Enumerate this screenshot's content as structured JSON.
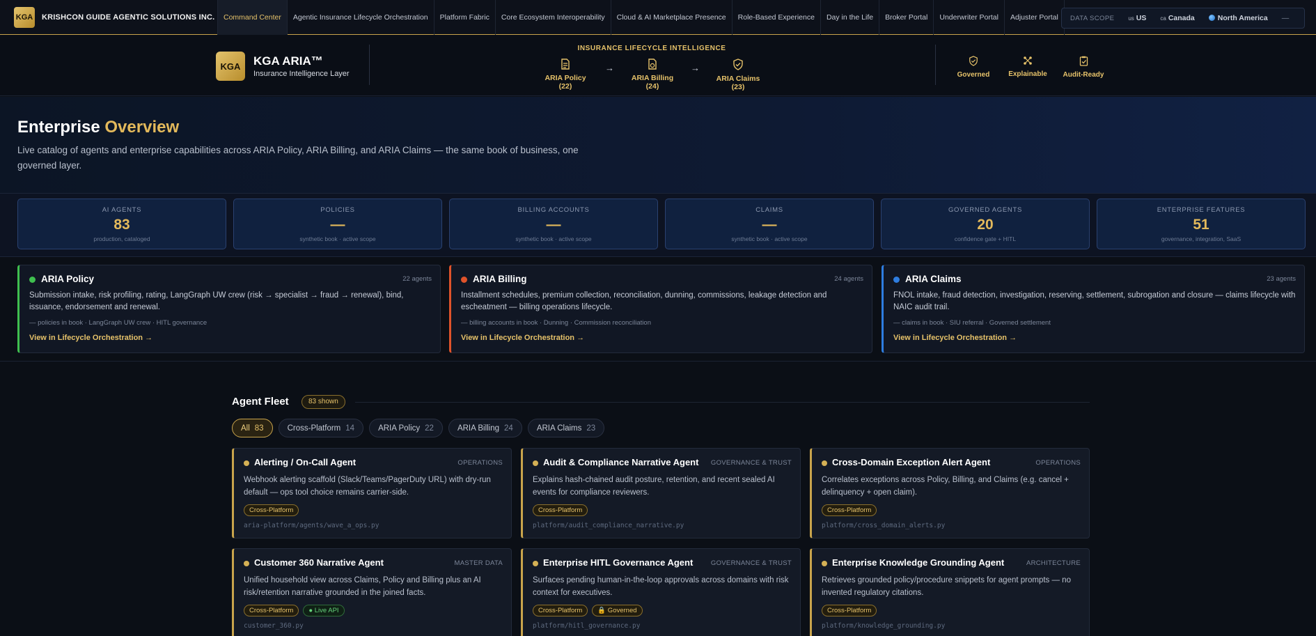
{
  "top_bar": {
    "logo_text": "KGA",
    "brand_name": "KRISHCON GUIDE AGENTIC SOLUTIONS INC.",
    "nav": [
      "Command Center",
      "Agentic Insurance Lifecycle Orchestration",
      "Platform Fabric",
      "Core Ecosystem Interoperability",
      "Cloud & AI Marketplace Presence",
      "Role-Based Experience",
      "Day in the Life",
      "Broker Portal",
      "Underwriter Portal",
      "Adjuster Portal"
    ],
    "active_nav": "Command Center",
    "data_scope": {
      "label": "DATA SCOPE",
      "options": [
        {
          "flag": "us",
          "label": "US"
        },
        {
          "flag": "ca",
          "label": "Canada"
        },
        {
          "flag": "globe",
          "label": "North America"
        }
      ],
      "trailing": "—"
    }
  },
  "aria_header": {
    "logo_text": "KGA",
    "title": "KGA ARIA™",
    "subtitle": "Insurance Intelligence Layer",
    "lifecycle_title": "INSURANCE LIFECYCLE INTELLIGENCE",
    "lifecycle_steps": [
      {
        "label": "ARIA Policy (22)",
        "icon": "document-icon"
      },
      {
        "label": "ARIA Billing (24)",
        "icon": "billing-document-icon"
      },
      {
        "label": "ARIA Claims (23)",
        "icon": "shield-check-icon"
      }
    ],
    "arrow": "→",
    "badges": [
      {
        "label": "Governed",
        "icon": "shield-icon"
      },
      {
        "label": "Explainable",
        "icon": "network-icon"
      },
      {
        "label": "Audit-Ready",
        "icon": "clipboard-check-icon"
      }
    ]
  },
  "hero": {
    "title_main": "Enterprise",
    "title_accent": "Overview",
    "description": "Live catalog of agents and enterprise capabilities across ARIA Policy, ARIA Billing, and ARIA Claims — the same book of business, one governed layer."
  },
  "stats": [
    {
      "label": "AI AGENTS",
      "value": "83",
      "sub": "production, cataloged"
    },
    {
      "label": "POLICIES",
      "value": "—",
      "sub": "synthetic book · active scope"
    },
    {
      "label": "BILLING ACCOUNTS",
      "value": "—",
      "sub": "synthetic book · active scope"
    },
    {
      "label": "CLAIMS",
      "value": "—",
      "sub": "synthetic book · active scope"
    },
    {
      "label": "GOVERNED AGENTS",
      "value": "20",
      "sub": "confidence gate + HITL"
    },
    {
      "label": "ENTERPRISE FEATURES",
      "value": "51",
      "sub": "governance, integration, SaaS"
    }
  ],
  "domains": [
    {
      "name": "ARIA Policy",
      "count": "22 agents",
      "color": "#3fbf4f",
      "description": "Submission intake, risk profiling, rating, LangGraph UW crew (risk → specialist → fraud → renewal), bind, issuance, endorsement and renewal.",
      "meta": "— policies in book · LangGraph UW crew · HITL governance",
      "link": "View in Lifecycle Orchestration →"
    },
    {
      "name": "ARIA Billing",
      "count": "24 agents",
      "color": "#e0532a",
      "description": "Installment schedules, premium collection, reconciliation, dunning, commissions, leakage detection and escheatment — billing operations lifecycle.",
      "meta": "— billing accounts in book · Dunning · Commission reconciliation",
      "link": "View in Lifecycle Orchestration →"
    },
    {
      "name": "ARIA Claims",
      "count": "23 agents",
      "color": "#2e7de0",
      "description": "FNOL intake, fraud detection, investigation, reserving, settlement, subrogation and closure — claims lifecycle with NAIC audit trail.",
      "meta": "— claims in book · SIU referral · Governed settlement",
      "link": "View in Lifecycle Orchestration →"
    }
  ],
  "fleet": {
    "title": "Agent Fleet",
    "shown_badge": "83 shown",
    "filters": [
      {
        "label": "All",
        "count": "83",
        "active": true
      },
      {
        "label": "Cross-Platform",
        "count": "14",
        "active": false
      },
      {
        "label": "ARIA Policy",
        "count": "22",
        "active": false
      },
      {
        "label": "ARIA Billing",
        "count": "24",
        "active": false
      },
      {
        "label": "ARIA Claims",
        "count": "23",
        "active": false
      }
    ],
    "agents": [
      {
        "name": "Alerting / On-Call Agent",
        "category": "OPERATIONS",
        "description": "Webhook alerting scaffold (Slack/Teams/PagerDuty URL) with dry-run default — ops tool choice remains carrier-side.",
        "tags": [
          {
            "text": "Cross-Platform",
            "style": "gold"
          }
        ],
        "path": "aria-platform/agents/wave_a_ops.py"
      },
      {
        "name": "Audit & Compliance Narrative Agent",
        "category": "GOVERNANCE & TRUST",
        "description": "Explains hash-chained audit posture, retention, and recent sealed AI events for compliance reviewers.",
        "tags": [
          {
            "text": "Cross-Platform",
            "style": "gold"
          }
        ],
        "path": "platform/audit_compliance_narrative.py"
      },
      {
        "name": "Cross-Domain Exception Alert Agent",
        "category": "OPERATIONS",
        "description": "Correlates exceptions across Policy, Billing, and Claims (e.g. cancel + delinquency + open claim).",
        "tags": [
          {
            "text": "Cross-Platform",
            "style": "gold"
          }
        ],
        "path": "platform/cross_domain_alerts.py"
      },
      {
        "name": "Customer 360 Narrative Agent",
        "category": "MASTER DATA",
        "description": "Unified household view across Claims, Policy and Billing plus an AI risk/retention narrative grounded in the joined facts.",
        "tags": [
          {
            "text": "Cross-Platform",
            "style": "gold"
          },
          {
            "text": "● Live API",
            "style": "green"
          }
        ],
        "path": "customer_360.py"
      },
      {
        "name": "Enterprise HITL Governance Agent",
        "category": "GOVERNANCE & TRUST",
        "description": "Surfaces pending human-in-the-loop approvals across domains with risk context for executives.",
        "tags": [
          {
            "text": "Cross-Platform",
            "style": "gold"
          },
          {
            "text": "🔒 Governed",
            "style": "gold"
          }
        ],
        "path": "platform/hitl_governance.py"
      },
      {
        "name": "Enterprise Knowledge Grounding Agent",
        "category": "ARCHITECTURE",
        "description": "Retrieves grounded policy/procedure snippets for agent prompts — no invented regulatory citations.",
        "tags": [
          {
            "text": "Cross-Platform",
            "style": "gold"
          }
        ],
        "path": "platform/knowledge_grounding.py"
      }
    ]
  }
}
